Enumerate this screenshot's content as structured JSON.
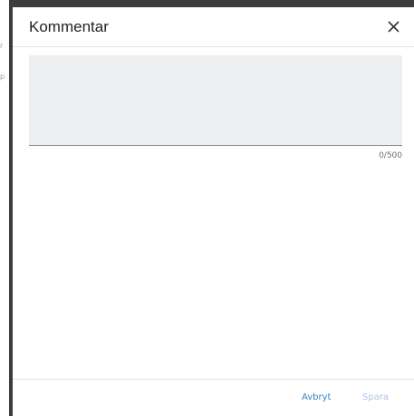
{
  "backdrop": {
    "glyph_1": "r",
    "glyph_2": "p"
  },
  "dialog": {
    "title": "Kommentar",
    "close_icon": "close-icon",
    "textarea": {
      "value": "",
      "placeholder": ""
    },
    "counter": "0/500",
    "actions": {
      "cancel_label": "Avbryt",
      "save_label": "Spara"
    }
  },
  "colors": {
    "accent": "#3b82c4",
    "accent_disabled": "#a9c6e4",
    "textarea_bg": "#eeeff0",
    "backdrop": "#3d3d3d"
  }
}
